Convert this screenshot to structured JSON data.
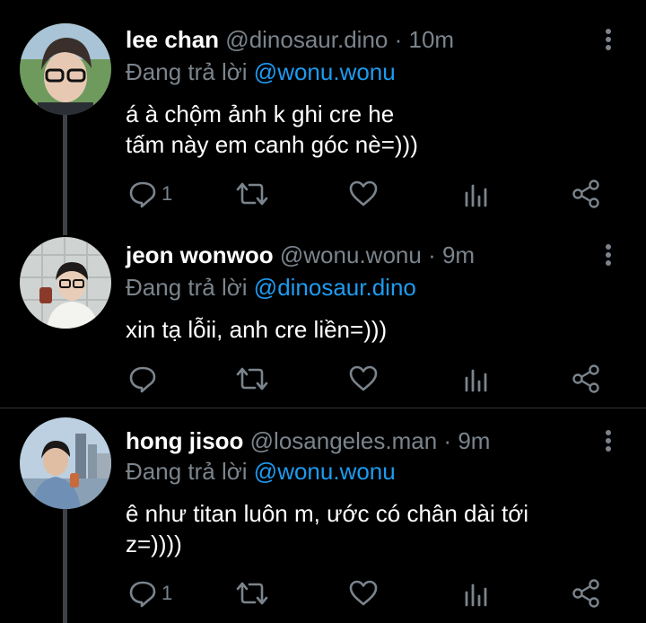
{
  "colors": {
    "background": "#000000",
    "mention": "#1d9bf0",
    "muted": "#7b848c",
    "text": "#ffffff"
  },
  "reply_prefix": "Đang trả lời",
  "tweets": [
    {
      "name": "lee chan",
      "handle": "@dinosaur.dino",
      "separator": "·",
      "time": "10m",
      "replying_to": "@wonu.wonu",
      "text_lines": [
        "á à chộm ảnh k ghi cre he",
        "tấm này em canh góc nè=)))"
      ],
      "reply_count": "1",
      "icons": [
        "reply-icon",
        "retweet-icon",
        "like-icon",
        "analytics-icon",
        "share-icon",
        "more-icon"
      ]
    },
    {
      "name": "jeon wonwoo",
      "handle": "@wonu.wonu",
      "separator": "·",
      "time": "9m",
      "replying_to": "@dinosaur.dino",
      "text_lines": [
        "xin tạ lỗii, anh cre liền=)))"
      ],
      "reply_count": "",
      "icons": [
        "reply-icon",
        "retweet-icon",
        "like-icon",
        "analytics-icon",
        "share-icon",
        "more-icon"
      ]
    },
    {
      "name": "hong jisoo",
      "handle": "@losangeles.man",
      "separator": "·",
      "time": "9m",
      "replying_to": "@wonu.wonu",
      "text_lines": [
        "ê như titan luôn m, ước có chân dài tới",
        "z=))))"
      ],
      "reply_count": "1",
      "icons": [
        "reply-icon",
        "retweet-icon",
        "like-icon",
        "analytics-icon",
        "share-icon",
        "more-icon"
      ]
    }
  ]
}
